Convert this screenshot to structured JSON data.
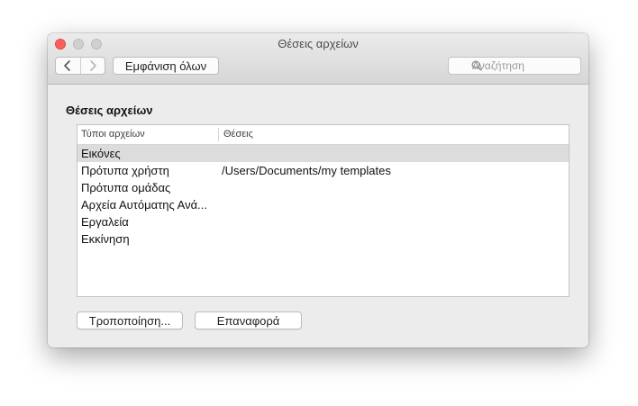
{
  "window": {
    "title": "Θέσεις αρχείων"
  },
  "toolbar": {
    "back_icon": "chevron-left-icon",
    "forward_icon": "chevron-right-icon",
    "show_all_label": "Εμφάνιση όλων",
    "search_placeholder": "Αναζήτηση",
    "search_icon": "magnifier-icon"
  },
  "section": {
    "title": "Θέσεις αρχείων"
  },
  "table": {
    "columns": [
      "Τύποι αρχείων",
      "Θέσεις"
    ],
    "rows": [
      {
        "type": "Εικόνες",
        "location": "",
        "selected": true
      },
      {
        "type": "Πρότυπα χρήστη",
        "location": "/Users/Documents/my templates",
        "selected": false
      },
      {
        "type": "Πρότυπα ομάδας",
        "location": "",
        "selected": false
      },
      {
        "type": "Αρχεία Αυτόματης Ανά...",
        "location": "",
        "selected": false
      },
      {
        "type": "Εργαλεία",
        "location": "",
        "selected": false
      },
      {
        "type": "Εκκίνηση",
        "location": "",
        "selected": false
      }
    ]
  },
  "buttons": {
    "modify_label": "Τροποποίηση...",
    "reset_label": "Επαναφορά"
  },
  "colors": {
    "close": "#fc605c",
    "selection": "#dcdcdc",
    "window_bg": "#ececec"
  }
}
